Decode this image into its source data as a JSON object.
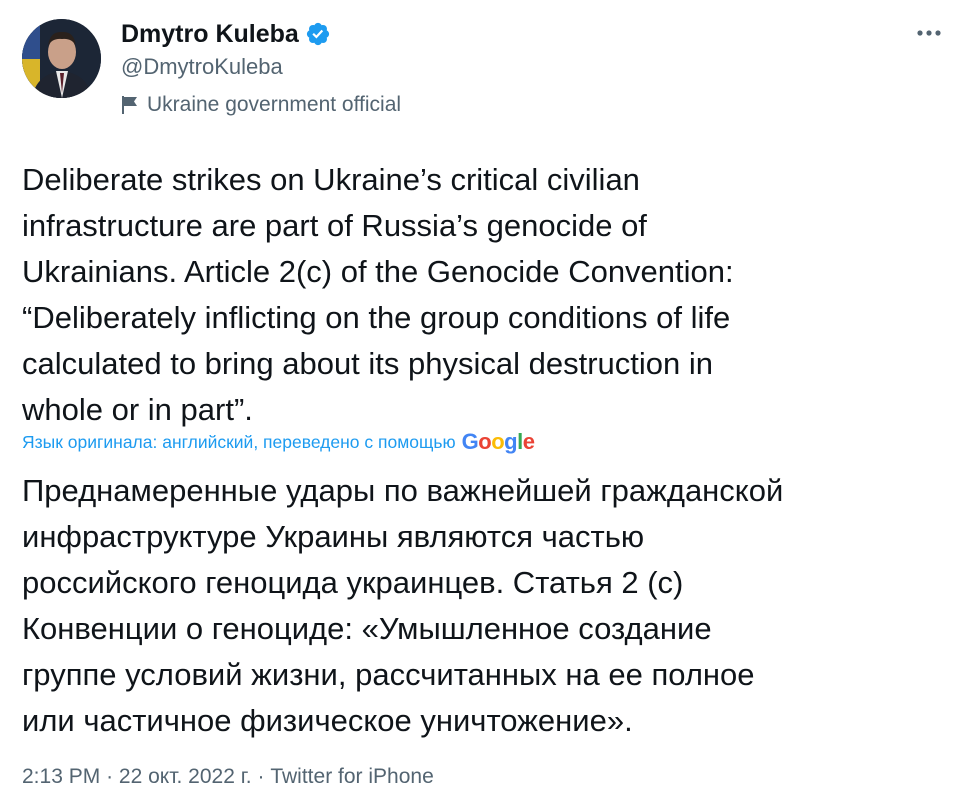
{
  "author": {
    "display_name": "Dmytro Kuleba",
    "handle": "@DmytroKuleba",
    "label": "Ukraine government official",
    "verified_color": "#1d9bf0"
  },
  "tweet": {
    "lines": [
      "Deliberate strikes on Ukraine’s critical civilian",
      "infrastructure are part of Russia’s genocide of",
      "Ukrainians. Article 2(c) of the Genocide Convention:",
      "“Deliberately inflicting on the group conditions of life",
      "calculated to bring about its physical destruction in",
      "whole or in part”."
    ]
  },
  "translation": {
    "note": "Язык оригинала: английский, переведено с помощью",
    "provider": "Google",
    "lines": [
      "Преднамеренные удары по важнейшей гражданской",
      "инфраструктуре Украины являются частью",
      "российского геноцида украинцев. Статья 2 (с)",
      "Конвенции о геноциде: «Умышленное создание",
      "группе условий жизни, рассчитанных на ее полное",
      "или частичное физическое уничтожение»."
    ]
  },
  "meta": {
    "time": "2:13 PM",
    "date": "22 окт. 2022 г.",
    "source": "Twitter for iPhone",
    "separator": "·"
  },
  "icons": {
    "more": "more-icon",
    "verified": "verified-badge-icon",
    "government": "government-flag-icon"
  }
}
